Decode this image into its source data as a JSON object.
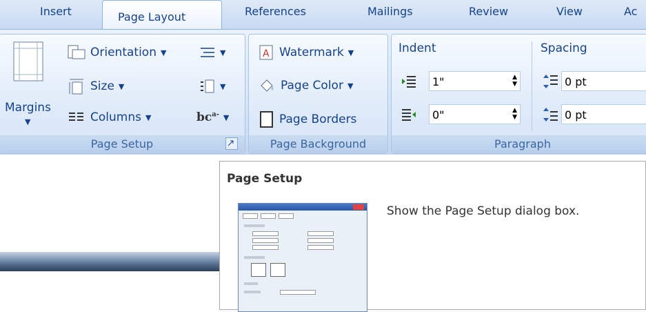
{
  "tabs": [
    "Insert",
    "Page Layout",
    "References",
    "Mailings",
    "Review",
    "View",
    "Ac"
  ],
  "active_tab": "Page Layout",
  "page_setup": {
    "margins_label": "Margins",
    "orientation_label": "Orientation",
    "size_label": "Size",
    "columns_label": "Columns",
    "group_label": "Page Setup",
    "launcher_icon": "dialog-launcher-icon"
  },
  "page_background": {
    "watermark_label": "Watermark",
    "page_color_label": "Page Color",
    "page_borders_label": "Page Borders",
    "group_label": "Page Background"
  },
  "paragraph": {
    "indent_title": "Indent",
    "spacing_title": "Spacing",
    "indent_left_value": "1\"",
    "indent_right_value": "0\"",
    "spacing_before_value": "0 pt",
    "spacing_after_value": "0 pt",
    "group_label": "Paragraph"
  },
  "tooltip": {
    "title": "Page Setup",
    "description": "Show the Page Setup dialog box."
  },
  "colors": {
    "ribbon_text": "#15428b",
    "ribbon_bg": "#dbe8f8",
    "group_label_bg": "#c9dcf3"
  }
}
